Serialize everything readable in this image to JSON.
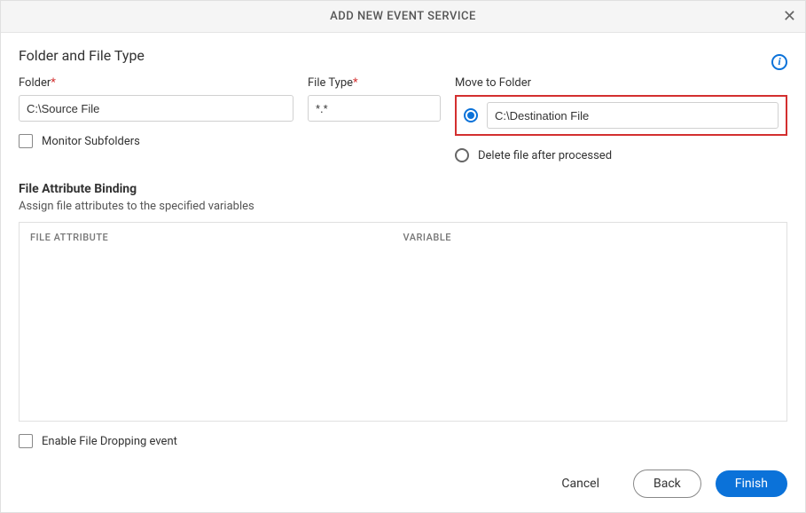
{
  "header": {
    "title": "ADD NEW EVENT SERVICE"
  },
  "section": {
    "title": "Folder and File Type"
  },
  "fields": {
    "folder_label": "Folder",
    "folder_value": "C:\\Source File",
    "filetype_label": "File Type",
    "filetype_value": "*.*",
    "move_to_folder_label": "Move to Folder",
    "move_to_folder_value": "C:\\Destination File",
    "delete_after_label": "Delete file after processed",
    "monitor_subfolders_label": "Monitor Subfolders"
  },
  "binding": {
    "title": "File Attribute Binding",
    "desc": "Assign file attributes to the specified variables",
    "col_attr": "FILE ATTRIBUTE",
    "col_var": "VARIABLE"
  },
  "enable_drop_label": "Enable File Dropping event",
  "footer": {
    "cancel": "Cancel",
    "back": "Back",
    "finish": "Finish"
  }
}
